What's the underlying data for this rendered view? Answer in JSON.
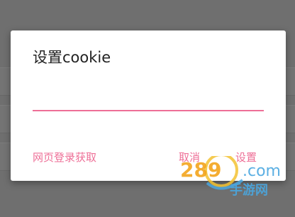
{
  "dialog": {
    "title": "设置cookie",
    "input": {
      "value": "",
      "placeholder": ""
    },
    "actions": {
      "web_login_label": "网页登录获取",
      "cancel_label": "取消",
      "confirm_label": "设置"
    }
  },
  "watermark": {
    "text": "289.com 手游网"
  },
  "colors": {
    "accent": "#ee6f97",
    "backdrop": "#6f6f6f",
    "dialog_bg": "#ffffff",
    "title": "#222222"
  }
}
